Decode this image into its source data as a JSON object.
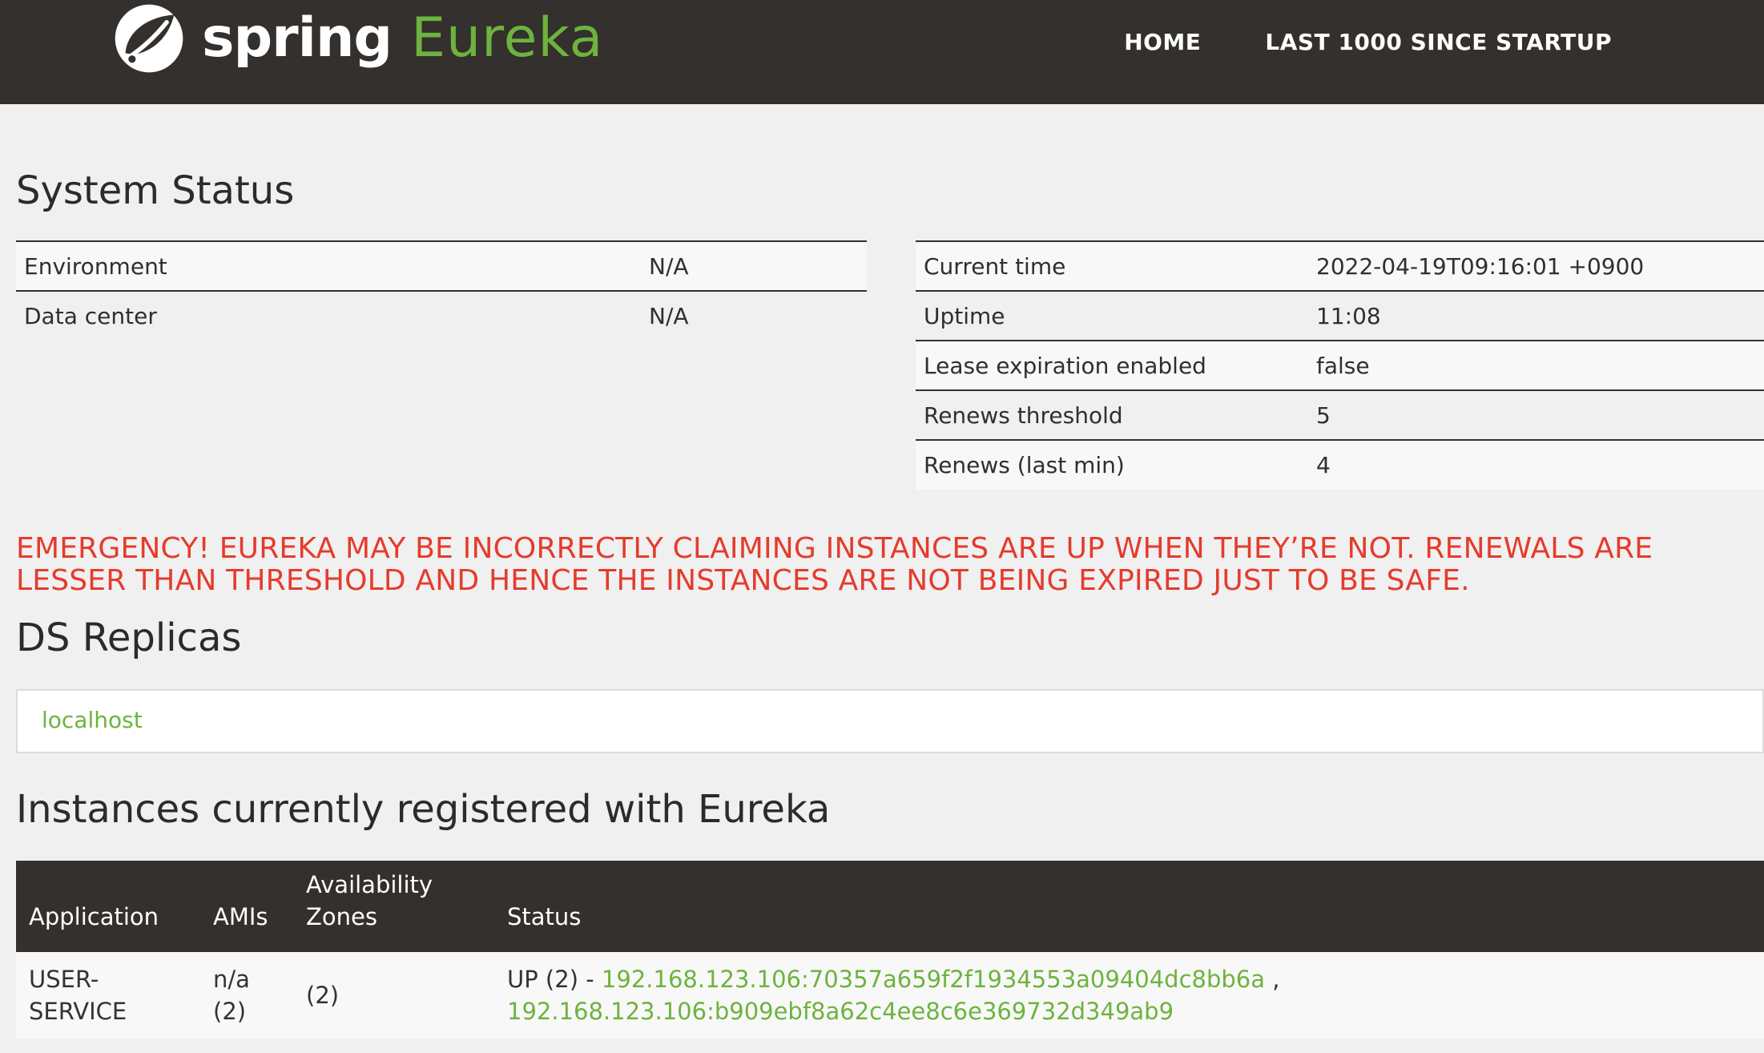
{
  "header": {
    "brand_spring": "spring",
    "brand_eureka": "Eureka",
    "nav": [
      {
        "label": "HOME"
      },
      {
        "label": "LAST 1000 SINCE STARTUP"
      }
    ],
    "colors": {
      "background": "#34302d",
      "accent": "#6db33f"
    },
    "logo_icon": "spring-leaf-icon"
  },
  "system_status": {
    "title": "System Status",
    "left_table": [
      {
        "label": "Environment",
        "value": "N/A"
      },
      {
        "label": "Data center",
        "value": "N/A"
      }
    ],
    "right_table": [
      {
        "label": "Current time",
        "value": "2022-04-19T09:16:01 +0900"
      },
      {
        "label": "Uptime",
        "value": "11:08"
      },
      {
        "label": "Lease expiration enabled",
        "value": "false"
      },
      {
        "label": "Renews threshold",
        "value": "5"
      },
      {
        "label": "Renews (last min)",
        "value": "4"
      }
    ]
  },
  "emergency": {
    "message": "EMERGENCY! EUREKA MAY BE INCORRECTLY CLAIMING INSTANCES ARE UP WHEN THEY’RE NOT. RENEWALS ARE LESSER THAN THRESHOLD AND HENCE THE INSTANCES ARE NOT BEING EXPIRED JUST TO BE SAFE.",
    "color": "#e53b2c"
  },
  "ds_replicas": {
    "title": "DS Replicas",
    "items": [
      {
        "label": "localhost"
      }
    ]
  },
  "instances": {
    "title": "Instances currently registered with Eureka",
    "columns": {
      "application": "Application",
      "amis": "AMIs",
      "availability_zones": "Availability Zones",
      "status": "Status"
    },
    "rows": [
      {
        "application": "USER-SERVICE",
        "amis": "n/a (2)",
        "availability_zones": "(2)",
        "status_prefix": "UP (2) - ",
        "instance_1": "192.168.123.106:70357a659f2f1934553a09404dc8bb6a",
        "separator": " ,",
        "instance_2": "192.168.123.106:b909ebf8a62c4ee8c6e369732d349ab9"
      }
    ]
  }
}
